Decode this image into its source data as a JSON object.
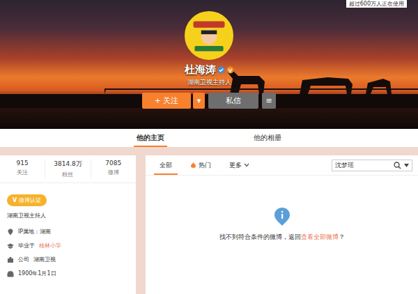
{
  "top_bar": {
    "notice": "超过600万人正在使用"
  },
  "profile": {
    "name": "杜海涛",
    "title": "湖南卫视主持人"
  },
  "actions": [
    {
      "kind": "follow",
      "label": "+ 关注"
    },
    {
      "kind": "dropdown",
      "label": "▾"
    },
    {
      "kind": "message",
      "label": "私信"
    },
    {
      "kind": "menu",
      "label": "≡"
    }
  ],
  "tabs": [
    {
      "label": "他的主页",
      "selected": true
    },
    {
      "label": "他的相册",
      "selected": false
    }
  ],
  "stats": [
    {
      "value": "915",
      "label": "关注"
    },
    {
      "value": "3814.8万",
      "label": "粉丝"
    },
    {
      "value": "7085",
      "label": "微博"
    }
  ],
  "verification": {
    "icon": "V",
    "badge": "微博认证",
    "text": "湖南卫视主持人"
  },
  "info": [
    {
      "kind": "location",
      "label": "IP属地：湖南",
      "link": ""
    },
    {
      "kind": "school",
      "label": "毕业于",
      "link": "桂林小学"
    },
    {
      "kind": "company",
      "label": "公司",
      "link": "湖南卫视"
    },
    {
      "kind": "birthday",
      "label": "1900年1月1日",
      "link": ""
    }
  ],
  "feed_tabs": [
    {
      "label": "全部",
      "kind": "plain",
      "selected": true
    },
    {
      "label": "热门",
      "kind": "hot",
      "selected": false
    },
    {
      "label": "更多",
      "kind": "more",
      "selected": false
    }
  ],
  "search": {
    "value": "沈梦瑶"
  },
  "empty": {
    "message": "找不到符合条件的微博，返回",
    "link": "查看全部微博",
    "suffix": "？"
  }
}
